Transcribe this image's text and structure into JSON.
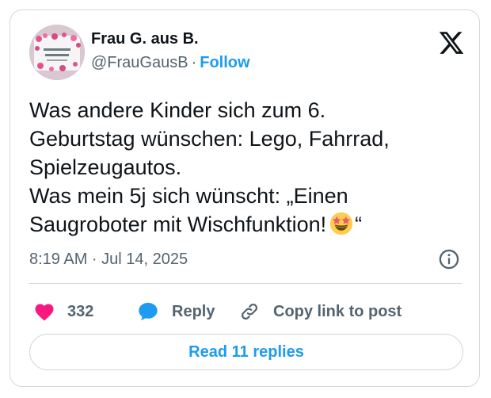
{
  "author": {
    "name": "Frau G. aus B.",
    "handle": "@FrauGausB",
    "separator": "·",
    "follow_label": "Follow"
  },
  "tweet": {
    "lines": [
      "Was andere Kinder sich zum 6.",
      "Geburtstag wünschen: Lego, Fahrrad,",
      "Spielzeugautos.",
      "Was mein 5j sich wünscht: „Einen",
      "Saugroboter mit Wischfunktion!"
    ],
    "closing_quote": "“",
    "emoji": "star-struck-emoji",
    "timestamp": "8:19 AM · Jul 14, 2025"
  },
  "actions": {
    "like_count": "332",
    "reply_label": "Reply",
    "copy_label": "Copy link to post"
  },
  "read_replies_label": "Read 11 replies",
  "icons": {
    "platform_logo": "x-logo-icon",
    "info": "info-icon",
    "like": "heart-icon",
    "reply": "speech-bubble-icon",
    "copy": "link-icon"
  },
  "colors": {
    "accent": "#1d9bf0",
    "like": "#f91880",
    "text": "#0f1419",
    "muted": "#536471",
    "border": "#cfd9de"
  }
}
